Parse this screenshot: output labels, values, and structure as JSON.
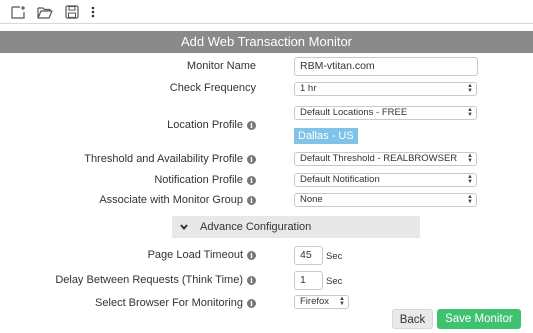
{
  "toolbar": {
    "icons": [
      "new-file-icon",
      "open-folder-icon",
      "save-icon",
      "more-vertical-icon"
    ]
  },
  "header": {
    "title": "Add Web Transaction Monitor"
  },
  "form": {
    "monitor_name": {
      "label": "Monitor Name",
      "value": "RBM-vtitan.com"
    },
    "check_frequency": {
      "label": "Check Frequency",
      "value": "1 hr"
    },
    "location_profile": {
      "label": "Location Profile",
      "value": "Default Locations - FREE",
      "tag": "Dallas - US"
    },
    "threshold": {
      "label": "Threshold and Availability Profile",
      "value": "Default Threshold - REALBROWSER"
    },
    "notification": {
      "label": "Notification Profile",
      "value": "Default Notification"
    },
    "monitor_group": {
      "label": "Associate with Monitor Group",
      "value": "None"
    }
  },
  "advance": {
    "label": "Advance Configuration"
  },
  "advanced": {
    "page_load_timeout": {
      "label": "Page Load Timeout",
      "value": "45",
      "unit": "Sec"
    },
    "think_time": {
      "label": "Delay Between Requests (Think Time)",
      "value": "1",
      "unit": "Sec"
    },
    "browser": {
      "label": "Select Browser For Monitoring",
      "value": "Firefox"
    }
  },
  "buttons": {
    "back": "Back",
    "save": "Save Monitor"
  },
  "colors": {
    "header_bg": "#8a8a8a",
    "save_bg": "#3ec270",
    "tag_bg": "#7fc4e8"
  }
}
